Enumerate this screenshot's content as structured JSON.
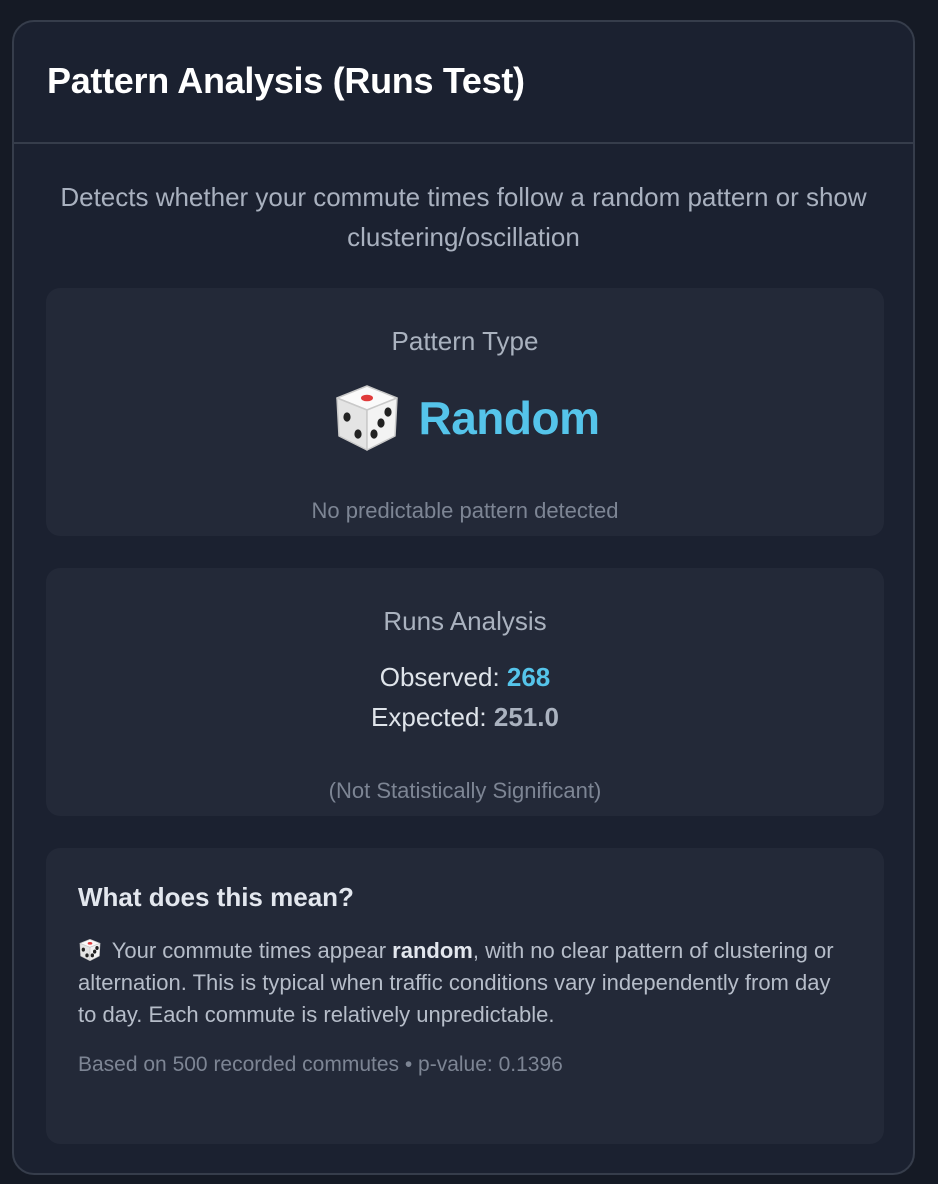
{
  "card": {
    "title": "Pattern Analysis (Runs Test)",
    "description": "Detects whether your commute times follow a random pattern or show clustering/oscillation"
  },
  "pattern": {
    "label": "Pattern Type",
    "icon": "dice-icon",
    "value": "Random",
    "note": "No predictable pattern detected",
    "accent": "#55c4ea"
  },
  "runs": {
    "label": "Runs Analysis",
    "observed_label": "Observed: ",
    "observed_value": "268",
    "expected_label": "Expected: ",
    "expected_value": "251.0",
    "significance": "(Not Statistically Significant)"
  },
  "meaning": {
    "title": "What does this mean?",
    "icon": "dice-icon",
    "text_before": " Your commute times appear ",
    "text_bold": "random",
    "text_after": ", with no clear pattern of clustering or alternation. This is typical when traffic conditions vary independently from day to day. Each commute is relatively unpredictable.",
    "meta": "Based on 500 recorded commutes • p-value: 0.1396"
  }
}
